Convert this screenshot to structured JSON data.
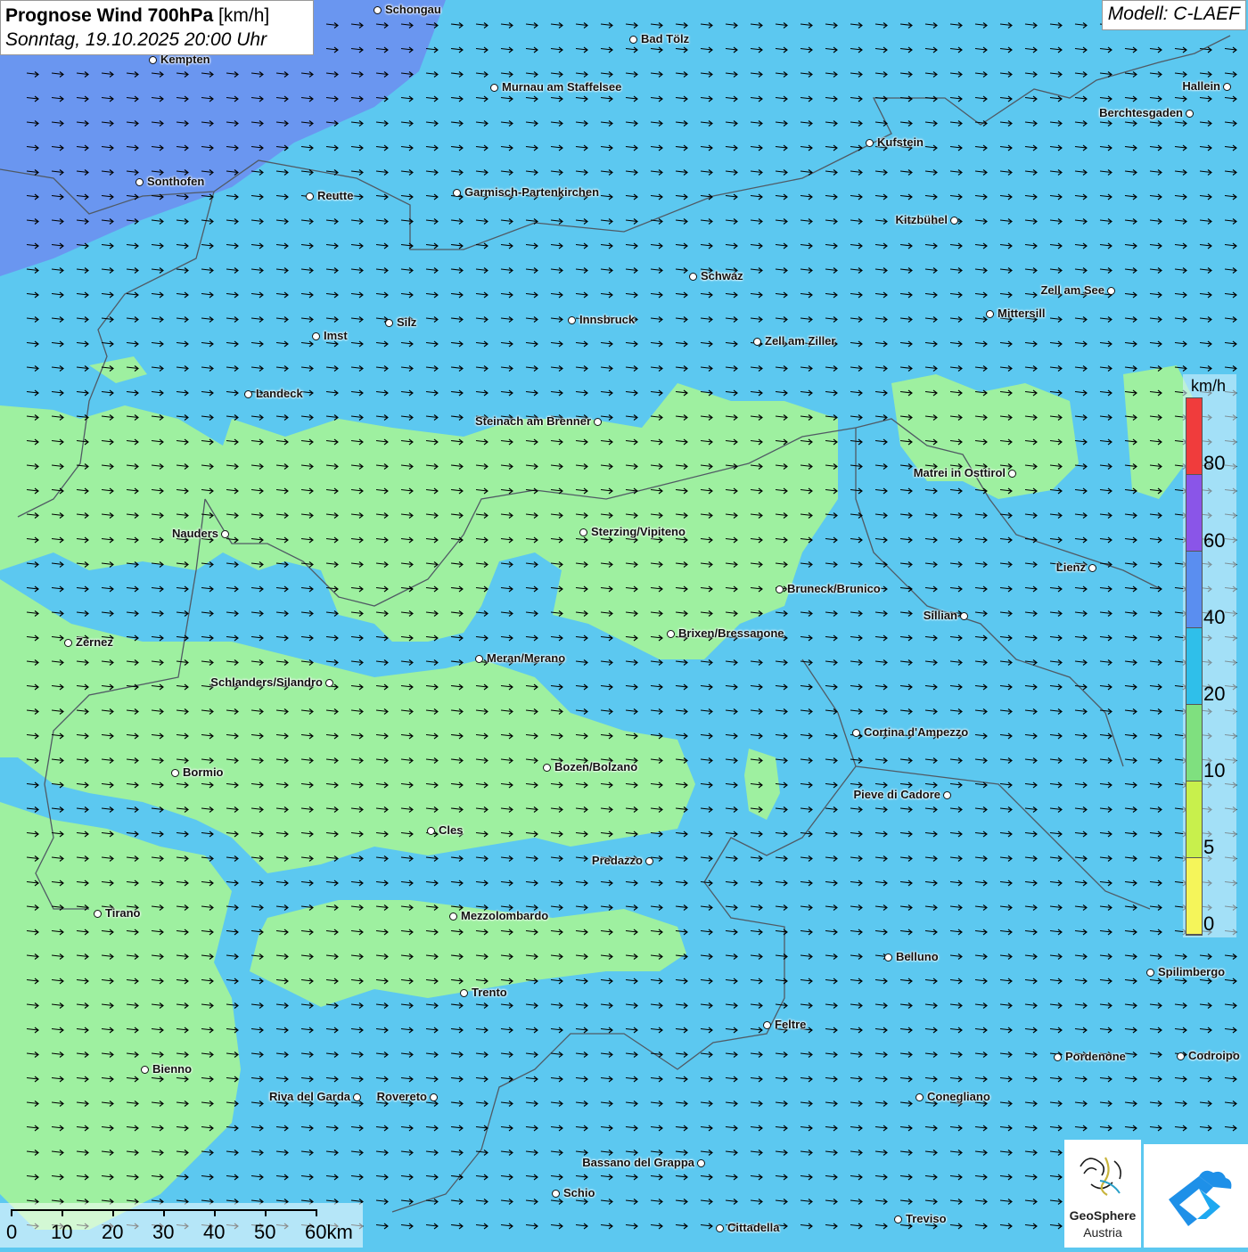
{
  "title": {
    "main": "Prognose Wind 700hPa",
    "unit": "[km/h]",
    "datetime": "Sonntag, 19.10.2025 20:00 Uhr"
  },
  "model": "Modell: C-LAEF",
  "legend": {
    "unit": "km/h",
    "ticks": [
      "80",
      "60",
      "40",
      "20",
      "10",
      "5",
      "0"
    ],
    "colors": [
      "#f03c3c",
      "#8a55e8",
      "#5a8ef0",
      "#2fbfea",
      "#7fe07f",
      "#c8f04c",
      "#f5f55a"
    ]
  },
  "scale_bar": {
    "labels": [
      "0",
      "10",
      "20",
      "30",
      "40",
      "50",
      "60km"
    ]
  },
  "colors": {
    "wind_10_20": "#9ef0a0",
    "wind_20_40": "#5cc8f0",
    "wind_40_60": "#6a96f0",
    "arrow": "#000000",
    "border": "#505a64"
  },
  "cities": [
    {
      "name": "Schongau"
    },
    {
      "name": "Bad Tölz"
    },
    {
      "name": "Kempten"
    },
    {
      "name": "Murnau am Staffelsee"
    },
    {
      "name": "Hallein"
    },
    {
      "name": "Berchtesgaden"
    },
    {
      "name": "Kufstein"
    },
    {
      "name": "Sonthofen"
    },
    {
      "name": "Reutte"
    },
    {
      "name": "Garmisch-Partenkirchen"
    },
    {
      "name": "Kitzbühel"
    },
    {
      "name": "Schwaz"
    },
    {
      "name": "Zell am See"
    },
    {
      "name": "Mittersill"
    },
    {
      "name": "Innsbruck"
    },
    {
      "name": "Silz"
    },
    {
      "name": "Imst"
    },
    {
      "name": "Zell am Ziller"
    },
    {
      "name": "Landeck"
    },
    {
      "name": "Steinach am Brenner"
    },
    {
      "name": "Matrei in Osttirol"
    },
    {
      "name": "Nauders"
    },
    {
      "name": "Sterzing/Vipiteno"
    },
    {
      "name": "Lienz"
    },
    {
      "name": "Bruneck/Brunico"
    },
    {
      "name": "Sillian"
    },
    {
      "name": "Brixen/Bressanone"
    },
    {
      "name": "Zernez"
    },
    {
      "name": "Meran/Merano"
    },
    {
      "name": "Schlanders/Silandro"
    },
    {
      "name": "Cortina d'Ampezzo"
    },
    {
      "name": "Bozen/Bolzano"
    },
    {
      "name": "Bormio"
    },
    {
      "name": "Pieve di Cadore"
    },
    {
      "name": "Cles"
    },
    {
      "name": "Predazzo"
    },
    {
      "name": "Tirano"
    },
    {
      "name": "Mezzolombardo"
    },
    {
      "name": "Belluno"
    },
    {
      "name": "Spilimbergo"
    },
    {
      "name": "Trento"
    },
    {
      "name": "Feltre"
    },
    {
      "name": "Bienno"
    },
    {
      "name": "Pordenone"
    },
    {
      "name": "Codroipo"
    },
    {
      "name": "Riva del Garda"
    },
    {
      "name": "Rovereto"
    },
    {
      "name": "Conegliano"
    },
    {
      "name": "Bassano del Grappa"
    },
    {
      "name": "Schio"
    },
    {
      "name": "Treviso"
    },
    {
      "name": "Cittadella"
    }
  ],
  "logo": {
    "line1": "GeoSphere",
    "line2": "Austria"
  }
}
